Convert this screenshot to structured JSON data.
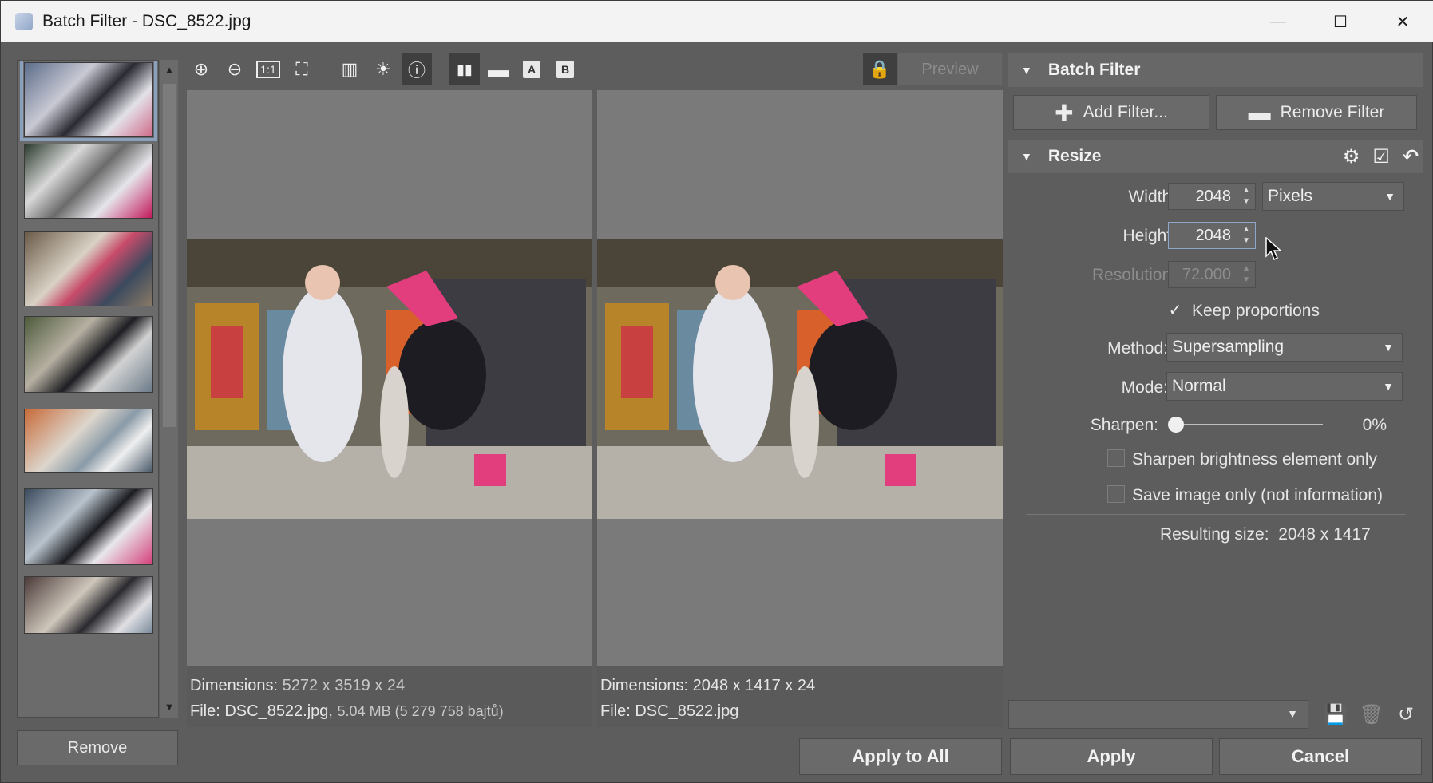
{
  "window": {
    "title": "Batch Filter - DSC_8522.jpg",
    "min_label": "—",
    "max_label": "☐",
    "close_label": "✕"
  },
  "thumbnails": {
    "count": 7,
    "remove_label": "Remove"
  },
  "toolbar": {
    "zoom_in": "⊕",
    "zoom_out": "⊖",
    "one_to_one": "1:1",
    "fit": "⛶",
    "histogram": "▥",
    "exposure": "☀",
    "info": "ⓘ",
    "split_vertical": "▮▮",
    "split_horizontal": "▬",
    "view_a": "A",
    "view_b": "B",
    "lock": "🔒",
    "preview_label": "Preview"
  },
  "left_panel": {
    "dimensions_label": "Dimensions:",
    "dimensions_value": "5272 x 3519 x 24",
    "file_label": "File: DSC_8522.jpg,",
    "file_size": "5.04 MB (5 279 758 bajtů)"
  },
  "right_panel": {
    "dimensions_label": "Dimensions:",
    "dimensions_value": "2048 x 1417 x 24",
    "file_label": "File: DSC_8522.jpg"
  },
  "batch_filter": {
    "section_title": "Batch Filter",
    "add_filter_label": "Add Filter...",
    "remove_filter_label": "Remove Filter"
  },
  "resize": {
    "section_title": "Resize",
    "width_label": "Width:",
    "width_value": "2048",
    "unit_value": "Pixels",
    "height_label": "Height:",
    "height_value": "2048",
    "resolution_label": "Resolution:",
    "resolution_value": "72.000",
    "keep_proportions_label": "Keep proportions",
    "keep_proportions_checked": true,
    "method_label": "Method:",
    "method_value": "Supersampling",
    "mode_label": "Mode:",
    "mode_value": "Normal",
    "sharpen_label": "Sharpen:",
    "sharpen_value": "0%",
    "sharpen_level": 0,
    "sharpen_brightness_label": "Sharpen brightness element only",
    "save_image_only_label": "Save image only (not information)",
    "resulting_size_label": "Resulting size:",
    "resulting_size_value": "2048 x 1417"
  },
  "footer": {
    "apply_all_label": "Apply to All",
    "apply_label": "Apply",
    "cancel_label": "Cancel"
  },
  "colors": {
    "window_bg": "#5d5d5d",
    "panel_bg": "#7a7a7a",
    "focus_border": "#8ea6c8",
    "selected_thumb": "#8aa0bd"
  }
}
